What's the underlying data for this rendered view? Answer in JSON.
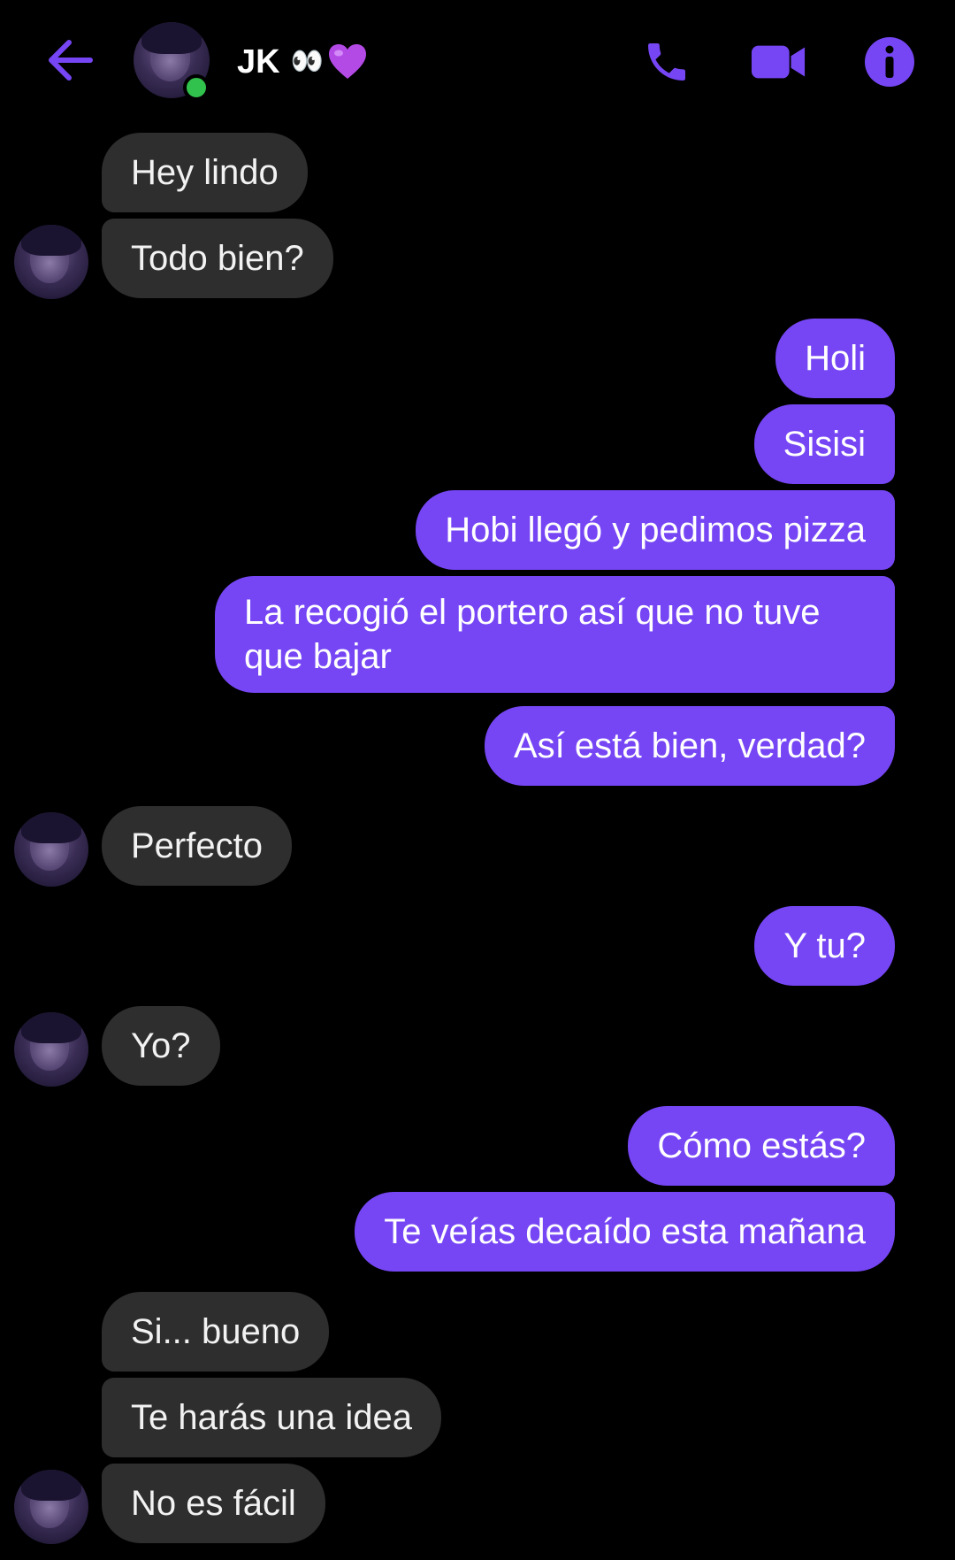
{
  "header": {
    "contact_name": "JK",
    "name_emoji": "👀",
    "heart_emoji": "💜",
    "online": true,
    "accent_color": "#7646f5",
    "online_color": "#31c24d"
  },
  "colors": {
    "incoming_bubble": "#2e2e2e",
    "outgoing_bubble": "#7646f5",
    "background": "#000000"
  },
  "messages": [
    {
      "from": "them",
      "text": "Hey lindo"
    },
    {
      "from": "them",
      "text": "Todo bien?"
    },
    {
      "from": "me",
      "text": "Holi"
    },
    {
      "from": "me",
      "text": "Sisisi"
    },
    {
      "from": "me",
      "text": "Hobi llegó y pedimos pizza"
    },
    {
      "from": "me",
      "text": "La recogió el portero así que no tuve que bajar"
    },
    {
      "from": "me",
      "text": "Así está bien, verdad?"
    },
    {
      "from": "them",
      "text": "Perfecto"
    },
    {
      "from": "me",
      "text": "Y tu?"
    },
    {
      "from": "them",
      "text": "Yo?"
    },
    {
      "from": "me",
      "text": "Cómo estás?"
    },
    {
      "from": "me",
      "text": "Te veías decaído esta mañana"
    },
    {
      "from": "them",
      "text": "Si... bueno"
    },
    {
      "from": "them",
      "text": "Te harás una idea"
    },
    {
      "from": "them",
      "text": "No es fácil"
    }
  ]
}
